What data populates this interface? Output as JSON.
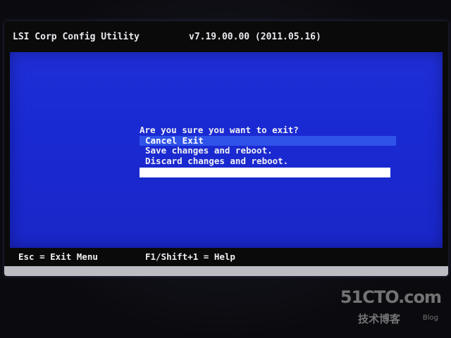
{
  "header": {
    "title": "LSI Corp Config Utility",
    "version": "v7.19.00.00 (2011.05.16)"
  },
  "dialog": {
    "question": "Are you sure you want to exit?",
    "options": [
      {
        "label": "Cancel Exit",
        "selected": true
      },
      {
        "label": "Save changes and reboot.",
        "selected": false
      },
      {
        "label": "Discard changes and reboot.",
        "selected": false
      }
    ]
  },
  "footer": {
    "exit_hint": "Esc = Exit Menu",
    "help_hint": "F1/Shift+1 = Help"
  },
  "watermark": {
    "brand": "51CTO.com",
    "sub": "技术博客",
    "blog": "Blog"
  },
  "colors": {
    "background_blue": "#1f2fd6",
    "selection_blue": "#2f53e9",
    "header_black": "#0a0a0a",
    "text": "#f0f0f4"
  }
}
